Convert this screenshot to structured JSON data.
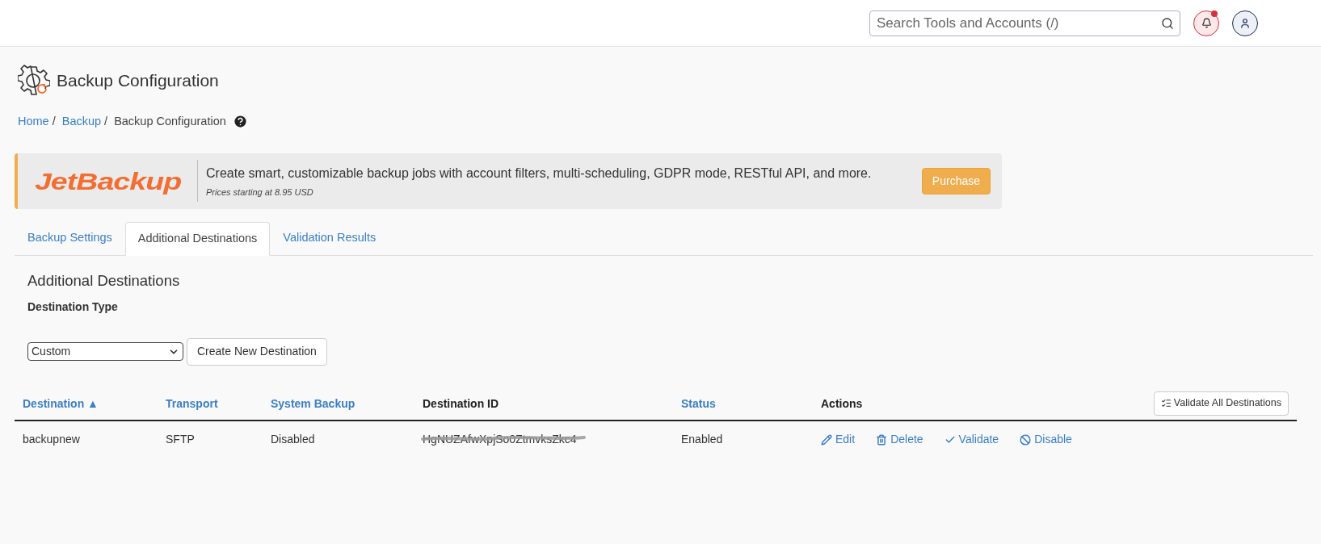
{
  "header": {
    "search": {
      "placeholder": "Search Tools and Accounts (/)"
    },
    "notifications": {
      "unread": true
    }
  },
  "page": {
    "title": "Backup Configuration"
  },
  "breadcrumb": [
    {
      "label": "Home",
      "link": true,
      "separator": "/"
    },
    {
      "label": "Backup",
      "link": true,
      "separator": "/"
    },
    {
      "label": "Backup Configuration",
      "link": false
    }
  ],
  "banner": {
    "logo": "JetBackup",
    "text": "Create smart, customizable backup jobs with account filters, multi-scheduling, GDPR mode, RESTful API, and more.",
    "note": "Prices starting at 8.95 USD",
    "button": "Purchase"
  },
  "tabs": [
    {
      "label": "Backup Settings",
      "selected": false
    },
    {
      "label": "Additional Destinations",
      "selected": true
    },
    {
      "label": "Validation Results",
      "selected": false
    }
  ],
  "section": {
    "title": "Additional Destinations",
    "field_label": "Destination Type",
    "select_value": "Custom",
    "create_button": "Create New Destination",
    "validate_all_button": "Validate All Destinations"
  },
  "table": {
    "columns": [
      {
        "label": "Destination ▲",
        "sortable": true
      },
      {
        "label": "Transport",
        "sortable": true
      },
      {
        "label": "System Backup",
        "sortable": true
      },
      {
        "label": "Destination ID",
        "sortable": false
      },
      {
        "label": "Status",
        "sortable": true
      },
      {
        "label": "Actions",
        "sortable": false
      }
    ],
    "rows": [
      {
        "cells": [
          "backupnew",
          "SFTP",
          "Disabled",
          "HgNUZAfwXpjSo0ZtmvksZkc4",
          "Enabled"
        ],
        "redacted_id": true,
        "actions": [
          {
            "kind": "edit",
            "label": "Edit"
          },
          {
            "kind": "delete",
            "label": "Delete"
          },
          {
            "kind": "validate",
            "label": "Validate"
          },
          {
            "kind": "disable",
            "label": "Disable"
          }
        ]
      }
    ]
  }
}
